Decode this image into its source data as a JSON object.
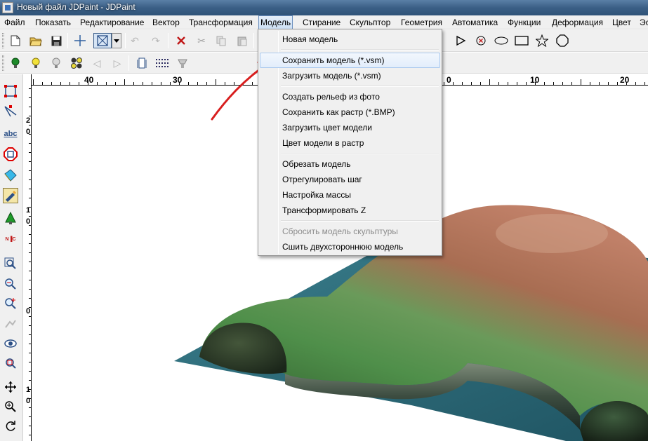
{
  "window": {
    "title": "Новый файл JDPaint - JDPaint"
  },
  "menubar": {
    "items": [
      {
        "label": "Файл",
        "active": false
      },
      {
        "label": "Показать",
        "active": false
      },
      {
        "label": "Редактирование",
        "active": false
      },
      {
        "label": "Вектор",
        "active": false
      },
      {
        "label": "Трансформация",
        "active": false
      },
      {
        "label": "Модель",
        "active": true
      },
      {
        "label": "Стирание",
        "active": false
      },
      {
        "label": "Скульптор",
        "active": false
      },
      {
        "label": "Геометрия",
        "active": false
      },
      {
        "label": "Автоматика",
        "active": false
      },
      {
        "label": "Функции",
        "active": false
      },
      {
        "label": "Деформация",
        "active": false
      },
      {
        "label": "Цвет",
        "active": false
      },
      {
        "label": "Эс",
        "active": false
      }
    ]
  },
  "model_menu": {
    "items": [
      {
        "label": "Новая модель",
        "state": "normal"
      },
      {
        "label": "Сохранить модель (*.vsm)",
        "state": "highlighted"
      },
      {
        "label": "Загрузить модель (*.vsm)",
        "state": "normal"
      },
      {
        "label": "Создать рельеф из фото",
        "state": "normal"
      },
      {
        "label": "Сохранить как растр (*.BMP)",
        "state": "normal"
      },
      {
        "label": "Загрузить цвет модели",
        "state": "normal"
      },
      {
        "label": "Цвет модели в растр",
        "state": "normal"
      },
      {
        "label": "Обрезать модель",
        "state": "normal"
      },
      {
        "label": "Отрегулировать шаг",
        "state": "normal"
      },
      {
        "label": "Настройка массы",
        "state": "normal"
      },
      {
        "label": "Трансформировать Z",
        "state": "normal"
      },
      {
        "label": "Сбросить модель скульптуры",
        "state": "disabled"
      },
      {
        "label": "Сшить двухстороннюю модель",
        "state": "normal"
      }
    ]
  },
  "toolbar_top": {
    "buttons": [
      "new-file-icon",
      "open-folder-icon",
      "save-disk-icon",
      "crosshair-icon",
      "select-box-icon",
      "dropdown-arrow-icon",
      "undo-icon",
      "redo-icon",
      "delete-x-icon",
      "cut-scissors-icon",
      "copy-icon",
      "paste-icon"
    ],
    "shape_buttons": [
      "triangle-arrow-icon",
      "circle-x-icon",
      "ellipse-icon",
      "rectangle-icon",
      "star-icon",
      "octagon-icon"
    ]
  },
  "toolbar_second": {
    "buttons": [
      "light-bulb-green-icon",
      "light-bulb-yellow-icon",
      "light-settings-icon",
      "lights-group-icon",
      "arrow-left-icon",
      "arrow-right-icon",
      "layers-box-icon",
      "pattern-icon",
      "lamp-icon"
    ]
  },
  "left_toolbar": {
    "buttons": [
      "node-edit-icon",
      "vector-tool-icon",
      "text-abc-icon",
      "stop-sign-icon",
      "fill-icon",
      "paint-brush-icon",
      "green-cone-icon",
      "nc-tool-icon",
      "zoom-box-icon",
      "zoom-out-icon",
      "zoom-in-icon",
      "zoom-disabled-icon",
      "eye-icon",
      "zoom-all-icon",
      "move-icon",
      "zoom-plus-icon",
      "rotate-icon"
    ]
  },
  "rulers": {
    "horizontal_labels": [
      "40",
      "30",
      "0",
      "10",
      "20"
    ],
    "vertical_labels": [
      "2",
      "0",
      "1",
      "0",
      "0",
      "1",
      "0"
    ]
  },
  "colors": {
    "menu_highlight": "#d9e8fa",
    "annotation_arrow": "#d81e1e",
    "model_base": "#2d6a78",
    "model_green": "#4f8f4a",
    "model_brown": "#a86d52"
  }
}
